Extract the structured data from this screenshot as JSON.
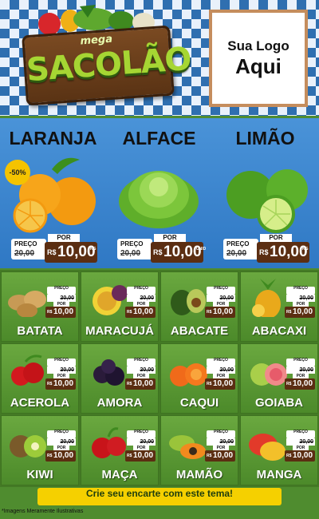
{
  "header": {
    "logo_small": "mega",
    "logo_main": "SACOLÃO",
    "your_logo_line1": "Sua Logo",
    "your_logo_line2": "Aqui"
  },
  "featured": [
    {
      "name": "LARANJA",
      "discount": "-50%",
      "price_label": "PREÇO",
      "old_price": "20,00",
      "por": "POR",
      "currency": "R$",
      "price": "10,00",
      "unit": "KG"
    },
    {
      "name": "ALFACE",
      "discount": "",
      "price_label": "PREÇO",
      "old_price": "20,00",
      "por": "POR",
      "currency": "R$",
      "price": "10,00",
      "unit": "UNID"
    },
    {
      "name": "LIMÃO",
      "discount": "",
      "price_label": "PREÇO",
      "old_price": "20,00",
      "por": "POR",
      "currency": "R$",
      "price": "10,00",
      "unit": "KG"
    }
  ],
  "products": [
    {
      "name": "BATATA",
      "price_label": "PREÇO",
      "old_price": "20,00",
      "por": "POR",
      "currency": "R$",
      "price": "10,00"
    },
    {
      "name": "MARACUJÁ",
      "price_label": "PREÇO",
      "old_price": "20,00",
      "por": "POR",
      "currency": "R$",
      "price": "10,00"
    },
    {
      "name": "ABACATE",
      "price_label": "PREÇO",
      "old_price": "20,00",
      "por": "POR",
      "currency": "R$",
      "price": "10,00"
    },
    {
      "name": "ABACAXI",
      "price_label": "PREÇO",
      "old_price": "20,00",
      "por": "POR",
      "currency": "R$",
      "price": "10,00"
    },
    {
      "name": "ACEROLA",
      "price_label": "PREÇO",
      "old_price": "20,00",
      "por": "POR",
      "currency": "R$",
      "price": "10,00"
    },
    {
      "name": "AMORA",
      "price_label": "PREÇO",
      "old_price": "20,00",
      "por": "POR",
      "currency": "R$",
      "price": "10,00"
    },
    {
      "name": "CAQUI",
      "price_label": "PREÇO",
      "old_price": "20,00",
      "por": "POR",
      "currency": "R$",
      "price": "10,00"
    },
    {
      "name": "GOIABA",
      "price_label": "PREÇO",
      "old_price": "20,00",
      "por": "POR",
      "currency": "R$",
      "price": "10,00"
    },
    {
      "name": "KIWI",
      "price_label": "PREÇO",
      "old_price": "20,00",
      "por": "POR",
      "currency": "R$",
      "price": "10,00"
    },
    {
      "name": "MAÇA",
      "price_label": "PREÇO",
      "old_price": "20,00",
      "por": "POR",
      "currency": "R$",
      "price": "10,00"
    },
    {
      "name": "MAMÃO",
      "price_label": "PREÇO",
      "old_price": "20,00",
      "por": "POR",
      "currency": "R$",
      "price": "10,00"
    },
    {
      "name": "MANGA",
      "price_label": "PREÇO",
      "old_price": "20,00",
      "por": "POR",
      "currency": "R$",
      "price": "10,00"
    }
  ],
  "footer": {
    "cta": "Crie seu encarte com este tema!",
    "disclaimer": "*Imagens Meramente Ilustrativas"
  }
}
